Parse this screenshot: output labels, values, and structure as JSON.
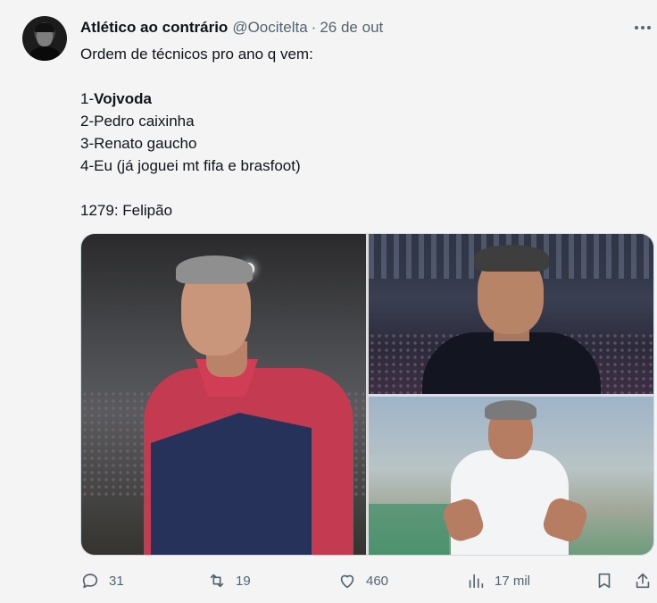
{
  "tweet": {
    "author": {
      "display_name": "Atlético ao contrário",
      "handle": "@Oocitelta",
      "separator": "·",
      "date": "26 de out"
    },
    "lines": [
      {
        "type": "text",
        "text": "Ordem de técnicos pro ano q vem:"
      },
      {
        "type": "blank"
      },
      {
        "type": "rich",
        "prefix": "1-",
        "bold": "Vojvoda"
      },
      {
        "type": "text",
        "text": "2-Pedro caixinha"
      },
      {
        "type": "text",
        "text": "3-Renato gaucho"
      },
      {
        "type": "text",
        "text": "4-Eu (já joguei mt fifa e brasfoot)"
      },
      {
        "type": "blank"
      },
      {
        "type": "text",
        "text": "1279: Felipão"
      }
    ],
    "media": [
      "coach-photo-vojvoda",
      "coach-photo-pedro-caixinha",
      "coach-photo-renato-gaucho"
    ],
    "actions": {
      "replies": "31",
      "reposts": "19",
      "likes": "460",
      "views": "17 mil"
    },
    "colors": {
      "text": "#0f1419",
      "secondary": "#536471",
      "background": "#f4f4f5"
    }
  }
}
